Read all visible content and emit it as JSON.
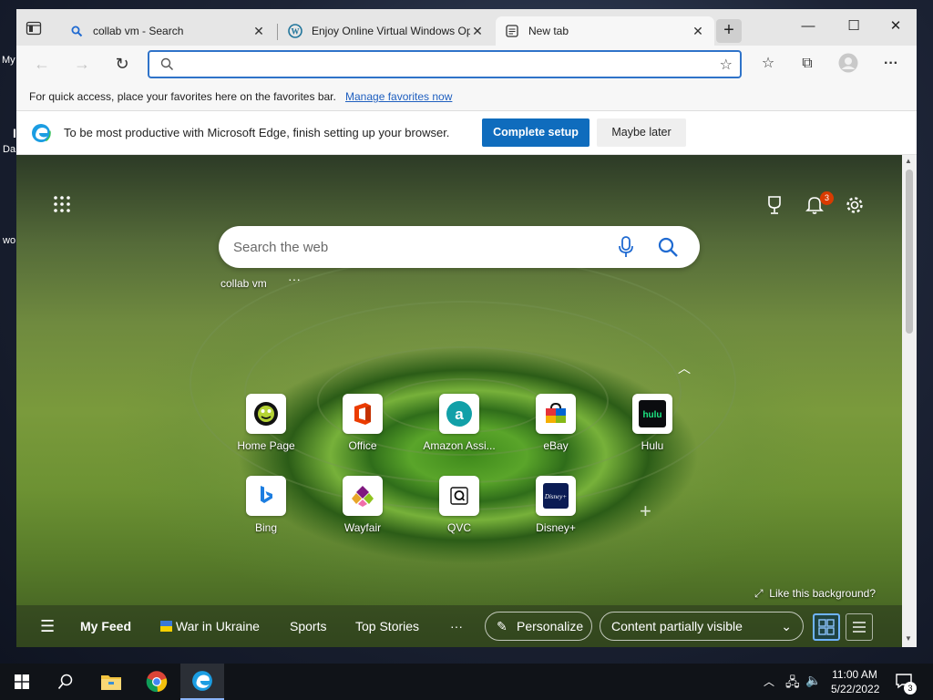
{
  "desktop": {
    "fragments": [
      "My",
      "Da",
      "wo",
      "I"
    ]
  },
  "browser": {
    "tabs": [
      {
        "label": "collab vm - Search",
        "icon": "search-favicon"
      },
      {
        "label": "Enjoy Online Virtual Windows Op",
        "icon": "wordpress-favicon"
      },
      {
        "label": "New tab",
        "icon": "newtab-favicon",
        "active": true
      }
    ],
    "address": {
      "value": "",
      "placeholder": ""
    },
    "favbar": {
      "message": "For quick access, place your favorites here on the favorites bar.",
      "link": "Manage favorites now"
    },
    "setup": {
      "message": "To be most productive with Microsoft Edge, finish setting up your browser.",
      "complete_label": "Complete setup",
      "later_label": "Maybe later"
    }
  },
  "ntp": {
    "search_placeholder": "Search the web",
    "recent_search": "collab vm",
    "recent_more": "···",
    "notification_count": "3",
    "quick_links": [
      {
        "label": "Home Page",
        "icon": "pbs-logo"
      },
      {
        "label": "Office",
        "icon": "office-logo"
      },
      {
        "label": "Amazon Assi...",
        "icon": "amazon-assistant-logo"
      },
      {
        "label": "eBay",
        "icon": "ebay-logo"
      },
      {
        "label": "Hulu",
        "icon": "hulu-logo"
      },
      {
        "label": "Bing",
        "icon": "bing-logo"
      },
      {
        "label": "Wayfair",
        "icon": "wayfair-logo"
      },
      {
        "label": "QVC",
        "icon": "qvc-logo"
      },
      {
        "label": "Disney+",
        "icon": "disney-plus-logo"
      }
    ],
    "background_prompt": "Like this background?",
    "feed": {
      "tabs": [
        "My Feed",
        "War in Ukraine",
        "Sports",
        "Top Stories"
      ],
      "more": "···",
      "personalize_label": "Personalize",
      "content_visibility": "Content partially visible"
    }
  },
  "taskbar": {
    "time": "11:00 AM",
    "date": "5/22/2022",
    "notifications": "3"
  },
  "colors": {
    "accent": "#0f6cbd",
    "badge": "#d83b01",
    "taskbar": "#101318"
  }
}
